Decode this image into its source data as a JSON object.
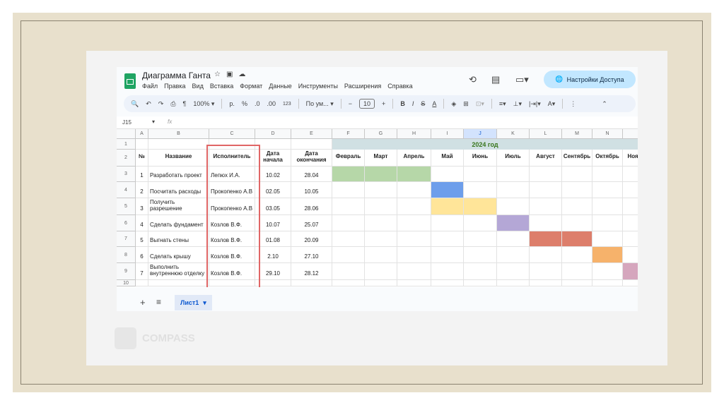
{
  "doc": {
    "title": "Диаграмма Ганта",
    "menu": [
      "Файл",
      "Правка",
      "Вид",
      "Вставка",
      "Формат",
      "Данные",
      "Инструменты",
      "Расширения",
      "Справка"
    ],
    "share_label": "Настройки Доступа"
  },
  "toolbar": {
    "zoom": "100%",
    "currency": "р.",
    "percent": "%",
    "dec_minus": ".0",
    "dec_plus": ".00",
    "num_format": "123",
    "font": "По ум...",
    "font_size": "10"
  },
  "formula_bar": {
    "cell_ref": "J15",
    "fx": "fx"
  },
  "columns": [
    "A",
    "B",
    "C",
    "D",
    "E",
    "F",
    "G",
    "H",
    "I",
    "J",
    "K",
    "L",
    "M",
    "N",
    ""
  ],
  "selected_column": "J",
  "year_label": "2024 год",
  "headers": [
    "№",
    "Название",
    "Исполнитель",
    "Дата начала",
    "Дата окончания"
  ],
  "months": [
    "Февраль",
    "Март",
    "Апрель",
    "Май",
    "Июнь",
    "Июль",
    "Август",
    "Сентябрь",
    "Октябрь",
    "Ноябрь"
  ],
  "tasks": [
    {
      "n": "1",
      "name": "Разработать проект",
      "who": "Лепюх И.А.",
      "start": "10.02",
      "end": "28.04",
      "from": 0,
      "to": 2,
      "color": "#b6d7a8"
    },
    {
      "n": "2",
      "name": "Посчитать расходы",
      "who": "Прокопенко А.В",
      "start": "02.05",
      "end": "10.05",
      "from": 3,
      "to": 3,
      "color": "#6d9eeb"
    },
    {
      "n": "3",
      "name": "Получить разрешение",
      "who": "Прокопенко А.В",
      "start": "03.05",
      "end": "28.06",
      "from": 3,
      "to": 4,
      "color": "#ffe599"
    },
    {
      "n": "4",
      "name": "Сделать фундамент",
      "who": "Козлов В.Ф.",
      "start": "10.07",
      "end": "25.07",
      "from": 5,
      "to": 5,
      "color": "#b4a7d6"
    },
    {
      "n": "5",
      "name": "Выгнать стены",
      "who": "Козлов В.Ф.",
      "start": "01.08",
      "end": "20.09",
      "from": 6,
      "to": 7,
      "color": "#dd7e6b"
    },
    {
      "n": "6",
      "name": "Сделать крышу",
      "who": "Козлов В.Ф.",
      "start": "2.10",
      "end": "27.10",
      "from": 8,
      "to": 8,
      "color": "#f6b26b"
    },
    {
      "n": "7",
      "name": "Выполнить внутреннюю отделку",
      "who": "Козлов В.Ф.",
      "start": "29.10",
      "end": "28.12",
      "from": 9,
      "to": 9,
      "color": "#d5a6bd"
    }
  ],
  "sheet_tab": "Лист1",
  "watermark": "COMPASS"
}
